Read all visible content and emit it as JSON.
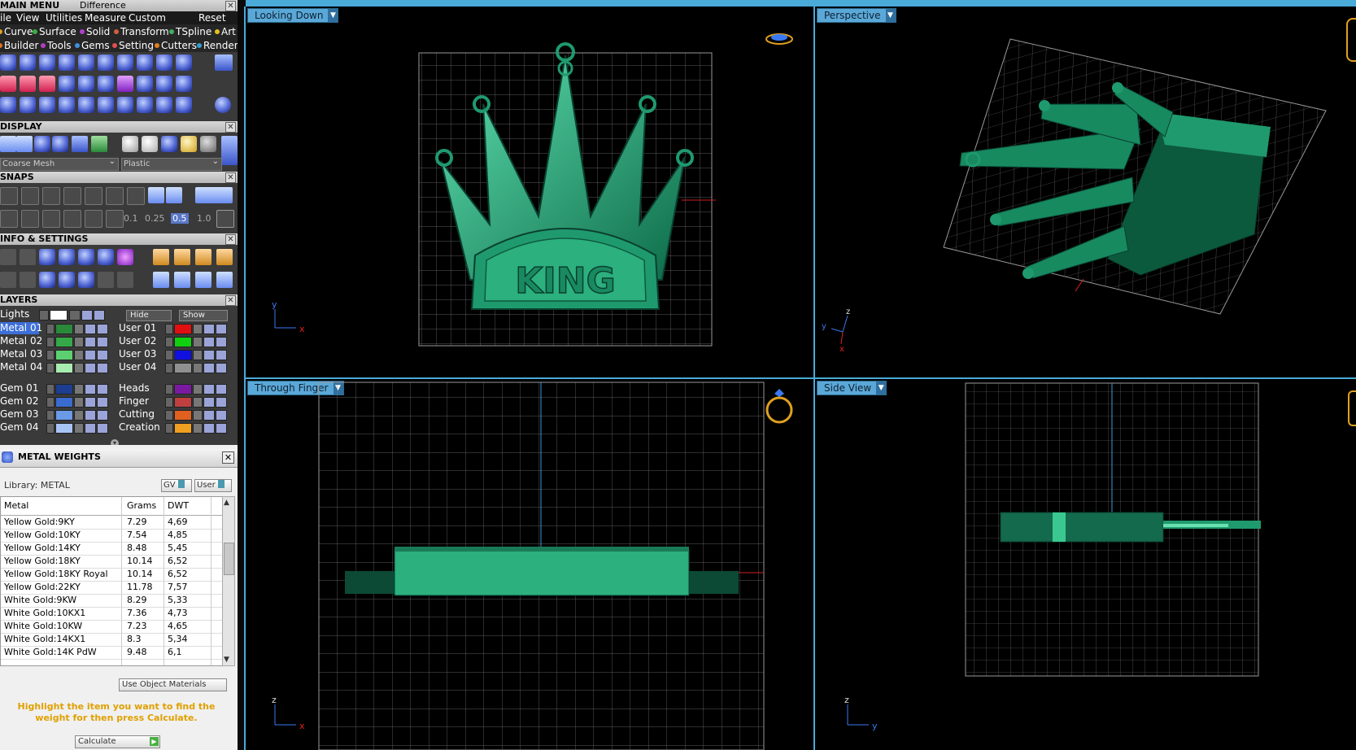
{
  "main_menu": {
    "title": "MAIN MENU",
    "mode": "Difference",
    "menu": [
      "ile",
      "View",
      "Utilities",
      "Measure",
      "Custom",
      "Reset"
    ],
    "tabs_row1": [
      {
        "label": "Curve",
        "color": "#e0a020"
      },
      {
        "label": "Surface",
        "color": "#3ab040"
      },
      {
        "label": "Solid",
        "color": "#b040d0"
      },
      {
        "label": "Transform",
        "color": "#d06040"
      },
      {
        "label": "TSpline",
        "color": "#40b060"
      },
      {
        "label": "Art",
        "color": "#e0c020"
      }
    ],
    "tabs_row2": [
      {
        "label": "Builder",
        "color": "#e07020"
      },
      {
        "label": "Tools",
        "color": "#b040c0"
      },
      {
        "label": "Gems",
        "color": "#4090e0"
      },
      {
        "label": "Setting",
        "color": "#e05050"
      },
      {
        "label": "Cutters",
        "color": "#e08020"
      },
      {
        "label": "Render",
        "color": "#30a0d0"
      }
    ]
  },
  "display": {
    "title": "DISPLAY",
    "mesh_select": "Coarse Mesh",
    "material_select": "Plastic"
  },
  "snaps": {
    "title": "SNAPS",
    "values": [
      "0.1",
      "0.25",
      "0.5",
      "1.0"
    ]
  },
  "info_settings": {
    "title": "INFO & SETTINGS"
  },
  "layers": {
    "title": "LAYERS",
    "lights_label": "Lights",
    "hide_label": "Hide",
    "show_label": "Show",
    "left": [
      {
        "name": "Metal 01",
        "color": "#2a8a3a",
        "selected": true
      },
      {
        "name": "Metal 02",
        "color": "#34a848"
      },
      {
        "name": "Metal 03",
        "color": "#5cd070"
      },
      {
        "name": "Metal 04",
        "color": "#a8ecb0"
      },
      {
        "name": "Gem 01",
        "color": "#1c3e90"
      },
      {
        "name": "Gem 02",
        "color": "#3a6cd0"
      },
      {
        "name": "Gem 03",
        "color": "#6a9ae8"
      },
      {
        "name": "Gem 04",
        "color": "#a8c4f4"
      }
    ],
    "right": [
      {
        "name": "User 01",
        "color": "#e01010"
      },
      {
        "name": "User 02",
        "color": "#10d010"
      },
      {
        "name": "User 03",
        "color": "#1010e0"
      },
      {
        "name": "User 04",
        "color": "#909090"
      },
      {
        "name": "Heads",
        "color": "#7a1aa0"
      },
      {
        "name": "Finger",
        "color": "#c04040"
      },
      {
        "name": "Cutting",
        "color": "#e06020"
      },
      {
        "name": "Creation",
        "color": "#f0a020"
      }
    ]
  },
  "metal_weights": {
    "title": "METAL WEIGHTS",
    "library_label": "Library: METAL",
    "gv_label": "GV",
    "user_label": "User",
    "columns": [
      "Metal",
      "Grams",
      "DWT"
    ],
    "rows": [
      [
        "Yellow Gold:9KY",
        "7.29",
        "4,69"
      ],
      [
        "Yellow Gold:10KY",
        "7.54",
        "4,85"
      ],
      [
        "Yellow Gold:14KY",
        "8.48",
        "5,45"
      ],
      [
        "Yellow Gold:18KY",
        "10.14",
        "6,52"
      ],
      [
        "Yellow Gold:18KY Royal",
        "10.14",
        "6,52"
      ],
      [
        "Yellow Gold:22KY",
        "11.78",
        "7,57"
      ],
      [
        "White Gold:9KW",
        "8.29",
        "5,33"
      ],
      [
        "White Gold:10KX1",
        "7.36",
        "4,73"
      ],
      [
        "White Gold:10KW",
        "7.23",
        "4,65"
      ],
      [
        "White Gold:14KX1",
        "8.3",
        "5,34"
      ],
      [
        "White Gold:14K PdW",
        "9.48",
        "6,1"
      ]
    ],
    "use_object_materials": "Use Object Materials",
    "hint": "Highlight the item you want to find the weight for then press Calculate.",
    "calculate_label": "Calculate"
  },
  "viewports": {
    "top_left": "Looking Down",
    "top_right": "Perspective",
    "bottom_left": "Through Finger",
    "bottom_right": "Side View"
  },
  "model": {
    "engraving": "KING",
    "color": "#1f9a6e"
  },
  "axes": {
    "looking_down": [
      "y",
      "x"
    ],
    "perspective": [
      "z",
      "y",
      "x"
    ],
    "through_finger": [
      "z",
      "x"
    ],
    "side_view": [
      "z",
      "y"
    ]
  }
}
